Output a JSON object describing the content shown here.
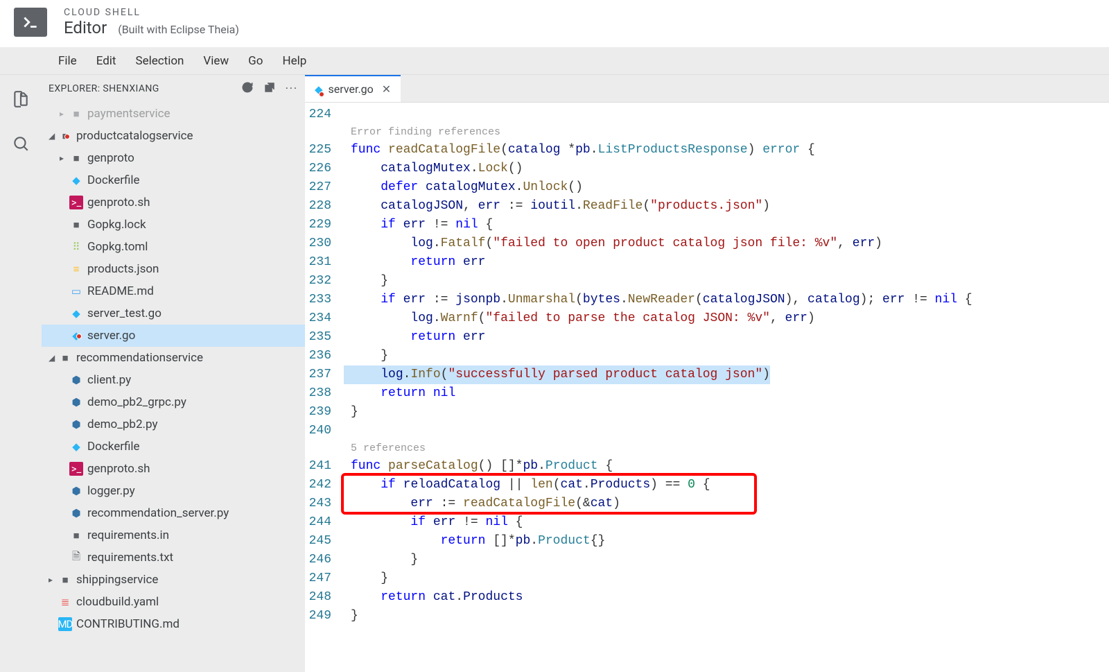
{
  "header": {
    "kicker": "CLOUD SHELL",
    "title": "Editor",
    "subtitle": "(Built with Eclipse Theia)"
  },
  "menu": {
    "items": [
      "File",
      "Edit",
      "Selection",
      "View",
      "Go",
      "Help"
    ]
  },
  "sidebar": {
    "title": "EXPLORER: SHENXIANG",
    "tree": [
      {
        "depth": 1,
        "chev": "▸",
        "folder": false,
        "iconClass": "ic-folder",
        "iconGlyph": "■",
        "label": "paymentservice",
        "dim": true
      },
      {
        "depth": 0,
        "chev": "◢",
        "folder": true,
        "iconClass": "ic-folder",
        "iconGlyph": "■",
        "label": "productcatalogservice",
        "err": true
      },
      {
        "depth": 1,
        "chev": "▸",
        "folder": true,
        "iconClass": "ic-folder",
        "iconGlyph": "■",
        "label": "genproto"
      },
      {
        "depth": 1,
        "chev": "",
        "folder": false,
        "iconClass": "ic-go",
        "iconGlyph": "◆",
        "label": "Dockerfile"
      },
      {
        "depth": 1,
        "chev": "",
        "folder": false,
        "iconClass": "ic-sh",
        "iconGlyph": ">_",
        "label": "genproto.sh"
      },
      {
        "depth": 1,
        "chev": "",
        "folder": false,
        "iconClass": "ic-lock",
        "iconGlyph": "■",
        "label": "Gopkg.lock"
      },
      {
        "depth": 1,
        "chev": "",
        "folder": false,
        "iconClass": "ic-toml",
        "iconGlyph": "⠿",
        "label": "Gopkg.toml"
      },
      {
        "depth": 1,
        "chev": "",
        "folder": false,
        "iconClass": "ic-json",
        "iconGlyph": "≡",
        "label": "products.json"
      },
      {
        "depth": 1,
        "chev": "",
        "folder": false,
        "iconClass": "ic-md",
        "iconGlyph": "▭",
        "label": "README.md"
      },
      {
        "depth": 1,
        "chev": "",
        "folder": false,
        "iconClass": "ic-go",
        "iconGlyph": "◆",
        "label": "server_test.go"
      },
      {
        "depth": 1,
        "chev": "",
        "folder": false,
        "iconClass": "ic-go",
        "iconGlyph": "◆",
        "label": "server.go",
        "selected": true,
        "err": true
      },
      {
        "depth": 0,
        "chev": "◢",
        "folder": true,
        "iconClass": "ic-folder",
        "iconGlyph": "■",
        "label": "recommendationservice"
      },
      {
        "depth": 1,
        "chev": "",
        "folder": false,
        "iconClass": "ic-py",
        "iconGlyph": "⬢",
        "label": "client.py"
      },
      {
        "depth": 1,
        "chev": "",
        "folder": false,
        "iconClass": "ic-py",
        "iconGlyph": "⬢",
        "label": "demo_pb2_grpc.py"
      },
      {
        "depth": 1,
        "chev": "",
        "folder": false,
        "iconClass": "ic-py",
        "iconGlyph": "⬢",
        "label": "demo_pb2.py"
      },
      {
        "depth": 1,
        "chev": "",
        "folder": false,
        "iconClass": "ic-go",
        "iconGlyph": "◆",
        "label": "Dockerfile"
      },
      {
        "depth": 1,
        "chev": "",
        "folder": false,
        "iconClass": "ic-sh",
        "iconGlyph": ">_",
        "label": "genproto.sh"
      },
      {
        "depth": 1,
        "chev": "",
        "folder": false,
        "iconClass": "ic-py",
        "iconGlyph": "⬢",
        "label": "logger.py"
      },
      {
        "depth": 1,
        "chev": "",
        "folder": false,
        "iconClass": "ic-py",
        "iconGlyph": "⬢",
        "label": "recommendation_server.py"
      },
      {
        "depth": 1,
        "chev": "",
        "folder": false,
        "iconClass": "ic-txt",
        "iconGlyph": "■",
        "label": "requirements.in"
      },
      {
        "depth": 1,
        "chev": "",
        "folder": false,
        "iconClass": "ic-txt",
        "iconGlyph": "🗎",
        "label": "requirements.txt"
      },
      {
        "depth": 0,
        "chev": "▸",
        "folder": true,
        "iconClass": "ic-folder",
        "iconGlyph": "■",
        "label": "shippingservice"
      },
      {
        "depth": 0,
        "chev": "",
        "folder": false,
        "iconClass": "ic-yaml",
        "iconGlyph": "≣",
        "label": "cloudbuild.yaml"
      },
      {
        "depth": 0,
        "chev": "",
        "folder": false,
        "iconClass": "ic-con",
        "iconGlyph": "MD",
        "label": "CONTRIBUTING.md"
      }
    ]
  },
  "tabs": {
    "open": [
      {
        "label": "server.go",
        "iconClass": "ic-go",
        "iconGlyph": "◆",
        "err": true
      }
    ]
  },
  "code": {
    "codelens1": "Error finding references",
    "codelens2": "5 references",
    "lines": [
      {
        "n": 224,
        "html": ""
      },
      {
        "lens": "codelens1"
      },
      {
        "n": 225,
        "html": "<span class='tok-kw'>func</span> <span class='tok-fn'>readCatalogFile</span>(<span class='tok-id'>catalog</span> *<span class='tok-id'>pb</span>.<span class='tok-type'>ListProductsResponse</span>) <span class='tok-type'>error</span> {"
      },
      {
        "n": 226,
        "html": "    <span class='tok-id'>catalogMutex</span>.<span class='tok-fn'>Lock</span>()"
      },
      {
        "n": 227,
        "html": "    <span class='tok-kw'>defer</span> <span class='tok-id'>catalogMutex</span>.<span class='tok-fn'>Unlock</span>()"
      },
      {
        "n": 228,
        "html": "    <span class='tok-id'>catalogJSON</span>, <span class='tok-id'>err</span> := <span class='tok-id'>ioutil</span>.<span class='tok-fn'>ReadFile</span>(<span class='tok-str'>\"products.json\"</span>)"
      },
      {
        "n": 229,
        "html": "    <span class='tok-kw'>if</span> <span class='tok-id'>err</span> != <span class='tok-kw'>nil</span> {"
      },
      {
        "n": 230,
        "html": "        <span class='tok-id'>log</span>.<span class='tok-fn'>Fatalf</span>(<span class='tok-str'>\"failed to open product catalog json file: %v\"</span>, <span class='tok-id'>err</span>)"
      },
      {
        "n": 231,
        "html": "        <span class='tok-kw'>return</span> <span class='tok-id'>err</span>"
      },
      {
        "n": 232,
        "html": "    }"
      },
      {
        "n": 233,
        "html": "    <span class='tok-kw'>if</span> <span class='tok-id'>err</span> := <span class='tok-id'>jsonpb</span>.<span class='tok-fn'>Unmarshal</span>(<span class='tok-id'>bytes</span>.<span class='tok-fn'>NewReader</span>(<span class='tok-id'>catalogJSON</span>), <span class='tok-id'>catalog</span>); <span class='tok-id'>err</span> != <span class='tok-kw'>nil</span> {"
      },
      {
        "n": 234,
        "html": "        <span class='tok-id'>log</span>.<span class='tok-fn'>Warnf</span>(<span class='tok-str'>\"failed to parse the catalog JSON: %v\"</span>, <span class='tok-id'>err</span>)"
      },
      {
        "n": 235,
        "html": "        <span class='tok-kw'>return</span> <span class='tok-id'>err</span>"
      },
      {
        "n": 236,
        "html": "    }"
      },
      {
        "n": 237,
        "hl": true,
        "html": "    <span class='tok-id'>log</span>.<span class='tok-fn'>Info</span>(<span class='tok-str'>\"successfully parsed product catalog json\"</span>)"
      },
      {
        "n": 238,
        "html": "    <span class='tok-kw'>return</span> <span class='tok-kw'>nil</span>"
      },
      {
        "n": 239,
        "html": "}"
      },
      {
        "n": 240,
        "html": ""
      },
      {
        "lens": "codelens2"
      },
      {
        "n": 241,
        "html": "<span class='tok-kw'>func</span> <span class='tok-fn'>parseCatalog</span>() []*<span class='tok-id'>pb</span>.<span class='tok-type'>Product</span> {"
      },
      {
        "n": 242,
        "box": "top",
        "html": "    <span class='tok-kw'>if</span> <span class='tok-id'>reloadCatalog</span> || <span class='tok-fn'>len</span>(<span class='tok-id'>cat</span>.<span class='tok-id'>Products</span>) == <span class='tok-num'>0</span> {"
      },
      {
        "n": 243,
        "box": "bot",
        "html": "        <span class='tok-id'>err</span> := <span class='tok-fn'>readCatalogFile</span>(&amp;<span class='tok-id'>cat</span>)"
      },
      {
        "n": 244,
        "html": "        <span class='tok-kw'>if</span> <span class='tok-id'>err</span> != <span class='tok-kw'>nil</span> {"
      },
      {
        "n": 245,
        "html": "            <span class='tok-kw'>return</span> []*<span class='tok-id'>pb</span>.<span class='tok-type'>Product</span>{}"
      },
      {
        "n": 246,
        "html": "        }"
      },
      {
        "n": 247,
        "html": "    }"
      },
      {
        "n": 248,
        "html": "    <span class='tok-kw'>return</span> <span class='tok-id'>cat</span>.<span class='tok-id'>Products</span>"
      },
      {
        "n": 249,
        "html": "}"
      }
    ]
  }
}
